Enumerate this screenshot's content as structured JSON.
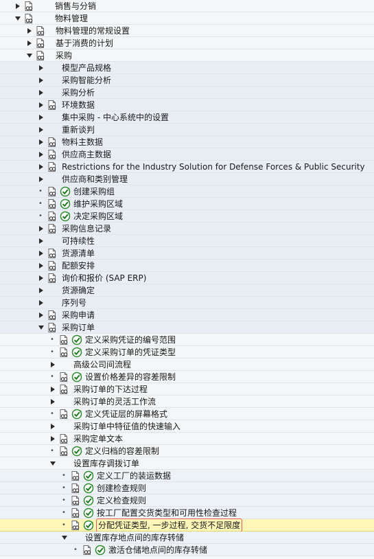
{
  "tree": [
    {
      "level": 1,
      "expanded": false,
      "has_doc": true,
      "has_exec": false,
      "label": "销售与分销"
    },
    {
      "level": 1,
      "expanded": true,
      "has_doc": true,
      "has_exec": false,
      "label": "物料管理"
    },
    {
      "level": 2,
      "expanded": false,
      "has_doc": true,
      "has_exec": false,
      "label": "物料管理的常规设置"
    },
    {
      "level": 2,
      "expanded": false,
      "has_doc": true,
      "has_exec": false,
      "label": "基于消费的计划"
    },
    {
      "level": 2,
      "expanded": true,
      "has_doc": true,
      "has_exec": false,
      "label": "采购"
    },
    {
      "level": 3,
      "expanded": false,
      "has_doc": false,
      "has_exec": false,
      "label": "模型产品规格"
    },
    {
      "level": 3,
      "expanded": false,
      "has_doc": false,
      "has_exec": false,
      "label": "采购智能分析"
    },
    {
      "level": 3,
      "expanded": false,
      "has_doc": false,
      "has_exec": false,
      "label": "采购分析"
    },
    {
      "level": 3,
      "expanded": false,
      "has_doc": true,
      "has_exec": false,
      "label": "环境数据"
    },
    {
      "level": 3,
      "expanded": false,
      "has_doc": false,
      "has_exec": false,
      "label": "集中采购 - 中心系统中的设置"
    },
    {
      "level": 3,
      "expanded": false,
      "has_doc": false,
      "has_exec": false,
      "label": "重新谈判"
    },
    {
      "level": 3,
      "expanded": false,
      "has_doc": true,
      "has_exec": false,
      "label": "物料主数据"
    },
    {
      "level": 3,
      "expanded": false,
      "has_doc": true,
      "has_exec": false,
      "label": "供应商主数据"
    },
    {
      "level": 3,
      "expanded": false,
      "has_doc": true,
      "has_exec": false,
      "label": "Restrictions for the Industry Solution for Defense Forces & Public Security"
    },
    {
      "level": 3,
      "expanded": false,
      "has_doc": false,
      "has_exec": false,
      "label": "供应商和类别管理"
    },
    {
      "level": 3,
      "leaf": true,
      "has_doc": true,
      "has_exec": true,
      "label": "创建采购组"
    },
    {
      "level": 3,
      "leaf": true,
      "has_doc": true,
      "has_exec": true,
      "label": "维护采购区域"
    },
    {
      "level": 3,
      "leaf": true,
      "has_doc": true,
      "has_exec": true,
      "label": "决定采购区域"
    },
    {
      "level": 3,
      "expanded": false,
      "has_doc": true,
      "has_exec": false,
      "label": "采购信息记录"
    },
    {
      "level": 3,
      "expanded": false,
      "has_doc": false,
      "has_exec": false,
      "label": "可持续性"
    },
    {
      "level": 3,
      "expanded": false,
      "has_doc": true,
      "has_exec": false,
      "label": "货源清单"
    },
    {
      "level": 3,
      "expanded": false,
      "has_doc": true,
      "has_exec": false,
      "label": "配额安排"
    },
    {
      "level": 3,
      "expanded": false,
      "has_doc": true,
      "has_exec": false,
      "label": "询价和报价 (SAP ERP)"
    },
    {
      "level": 3,
      "expanded": false,
      "has_doc": false,
      "has_exec": false,
      "label": "货源确定"
    },
    {
      "level": 3,
      "expanded": false,
      "has_doc": false,
      "has_exec": false,
      "label": "序列号"
    },
    {
      "level": 3,
      "expanded": false,
      "has_doc": true,
      "has_exec": false,
      "label": "采购申请"
    },
    {
      "level": 3,
      "expanded": true,
      "has_doc": true,
      "has_exec": false,
      "label": "采购订单"
    },
    {
      "level": 4,
      "leaf": true,
      "has_doc": true,
      "has_exec": true,
      "label": "定义采购凭证的编号范围"
    },
    {
      "level": 4,
      "leaf": true,
      "has_doc": true,
      "has_exec": true,
      "label": "定义采购订单的凭证类型"
    },
    {
      "level": 4,
      "expanded": false,
      "has_doc": false,
      "has_exec": false,
      "label": "高级公司间流程"
    },
    {
      "level": 4,
      "leaf": true,
      "has_doc": true,
      "has_exec": true,
      "label": "设置价格差异的容差限制"
    },
    {
      "level": 4,
      "expanded": false,
      "has_doc": true,
      "has_exec": false,
      "label": "采购订单的下达过程"
    },
    {
      "level": 4,
      "expanded": false,
      "has_doc": false,
      "has_exec": false,
      "label": "采购订单的灵活工作流"
    },
    {
      "level": 4,
      "leaf": true,
      "has_doc": true,
      "has_exec": true,
      "label": "定义凭证层的屏幕格式"
    },
    {
      "level": 4,
      "expanded": false,
      "has_doc": false,
      "has_exec": false,
      "label": "采购订单中特征值的快速输入"
    },
    {
      "level": 4,
      "expanded": false,
      "has_doc": true,
      "has_exec": false,
      "label": "采购定单文本"
    },
    {
      "level": 4,
      "leaf": true,
      "has_doc": true,
      "has_exec": true,
      "label": "定义归档的容差限制"
    },
    {
      "level": 4,
      "expanded": true,
      "has_doc": false,
      "has_exec": false,
      "label": "设置库存调拨订单"
    },
    {
      "level": 5,
      "leaf": true,
      "has_doc": true,
      "has_exec": true,
      "label": "定义工厂的装运数据"
    },
    {
      "level": 5,
      "leaf": true,
      "has_doc": true,
      "has_exec": true,
      "label": "创建检查规则"
    },
    {
      "level": 5,
      "leaf": true,
      "has_doc": true,
      "has_exec": true,
      "label": "定义检查规则"
    },
    {
      "level": 5,
      "leaf": true,
      "has_doc": true,
      "has_exec": true,
      "label": "按工厂配置交货类型和可用性检查过程"
    },
    {
      "level": 5,
      "leaf": true,
      "has_doc": true,
      "has_exec": true,
      "selected": true,
      "label": "分配凭证类型, 一步过程, 交货不足限度"
    },
    {
      "level": 5,
      "expanded": true,
      "has_doc": false,
      "has_exec": false,
      "label": "设置库存地点间的库存转储"
    },
    {
      "level": 6,
      "leaf": true,
      "has_doc": true,
      "has_exec": true,
      "label": "激活仓储地点间的库存转储"
    }
  ]
}
